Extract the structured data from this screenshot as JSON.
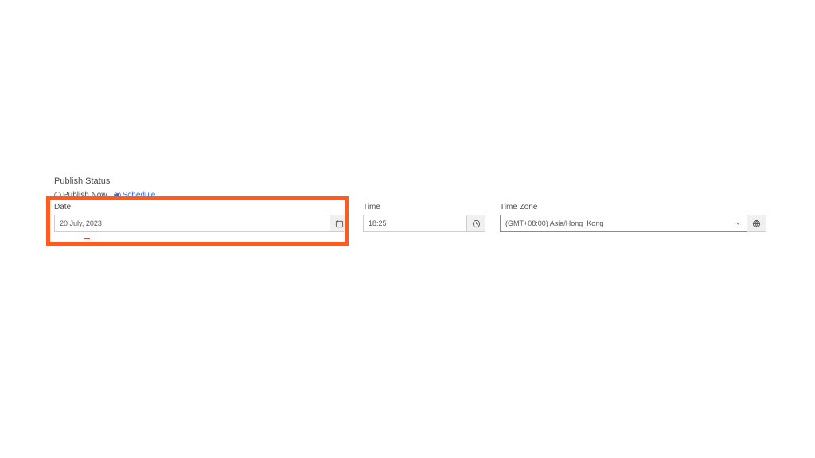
{
  "section": {
    "title": "Publish Status",
    "radios": {
      "publish_now": "Publish Now",
      "schedule": "Schedule"
    }
  },
  "date": {
    "label": "Date",
    "value": "20 July, 2023"
  },
  "time": {
    "label": "Time",
    "value": "18:25"
  },
  "timezone": {
    "label": "Time Zone",
    "value": "(GMT+08:00) Asia/Hong_Kong"
  }
}
